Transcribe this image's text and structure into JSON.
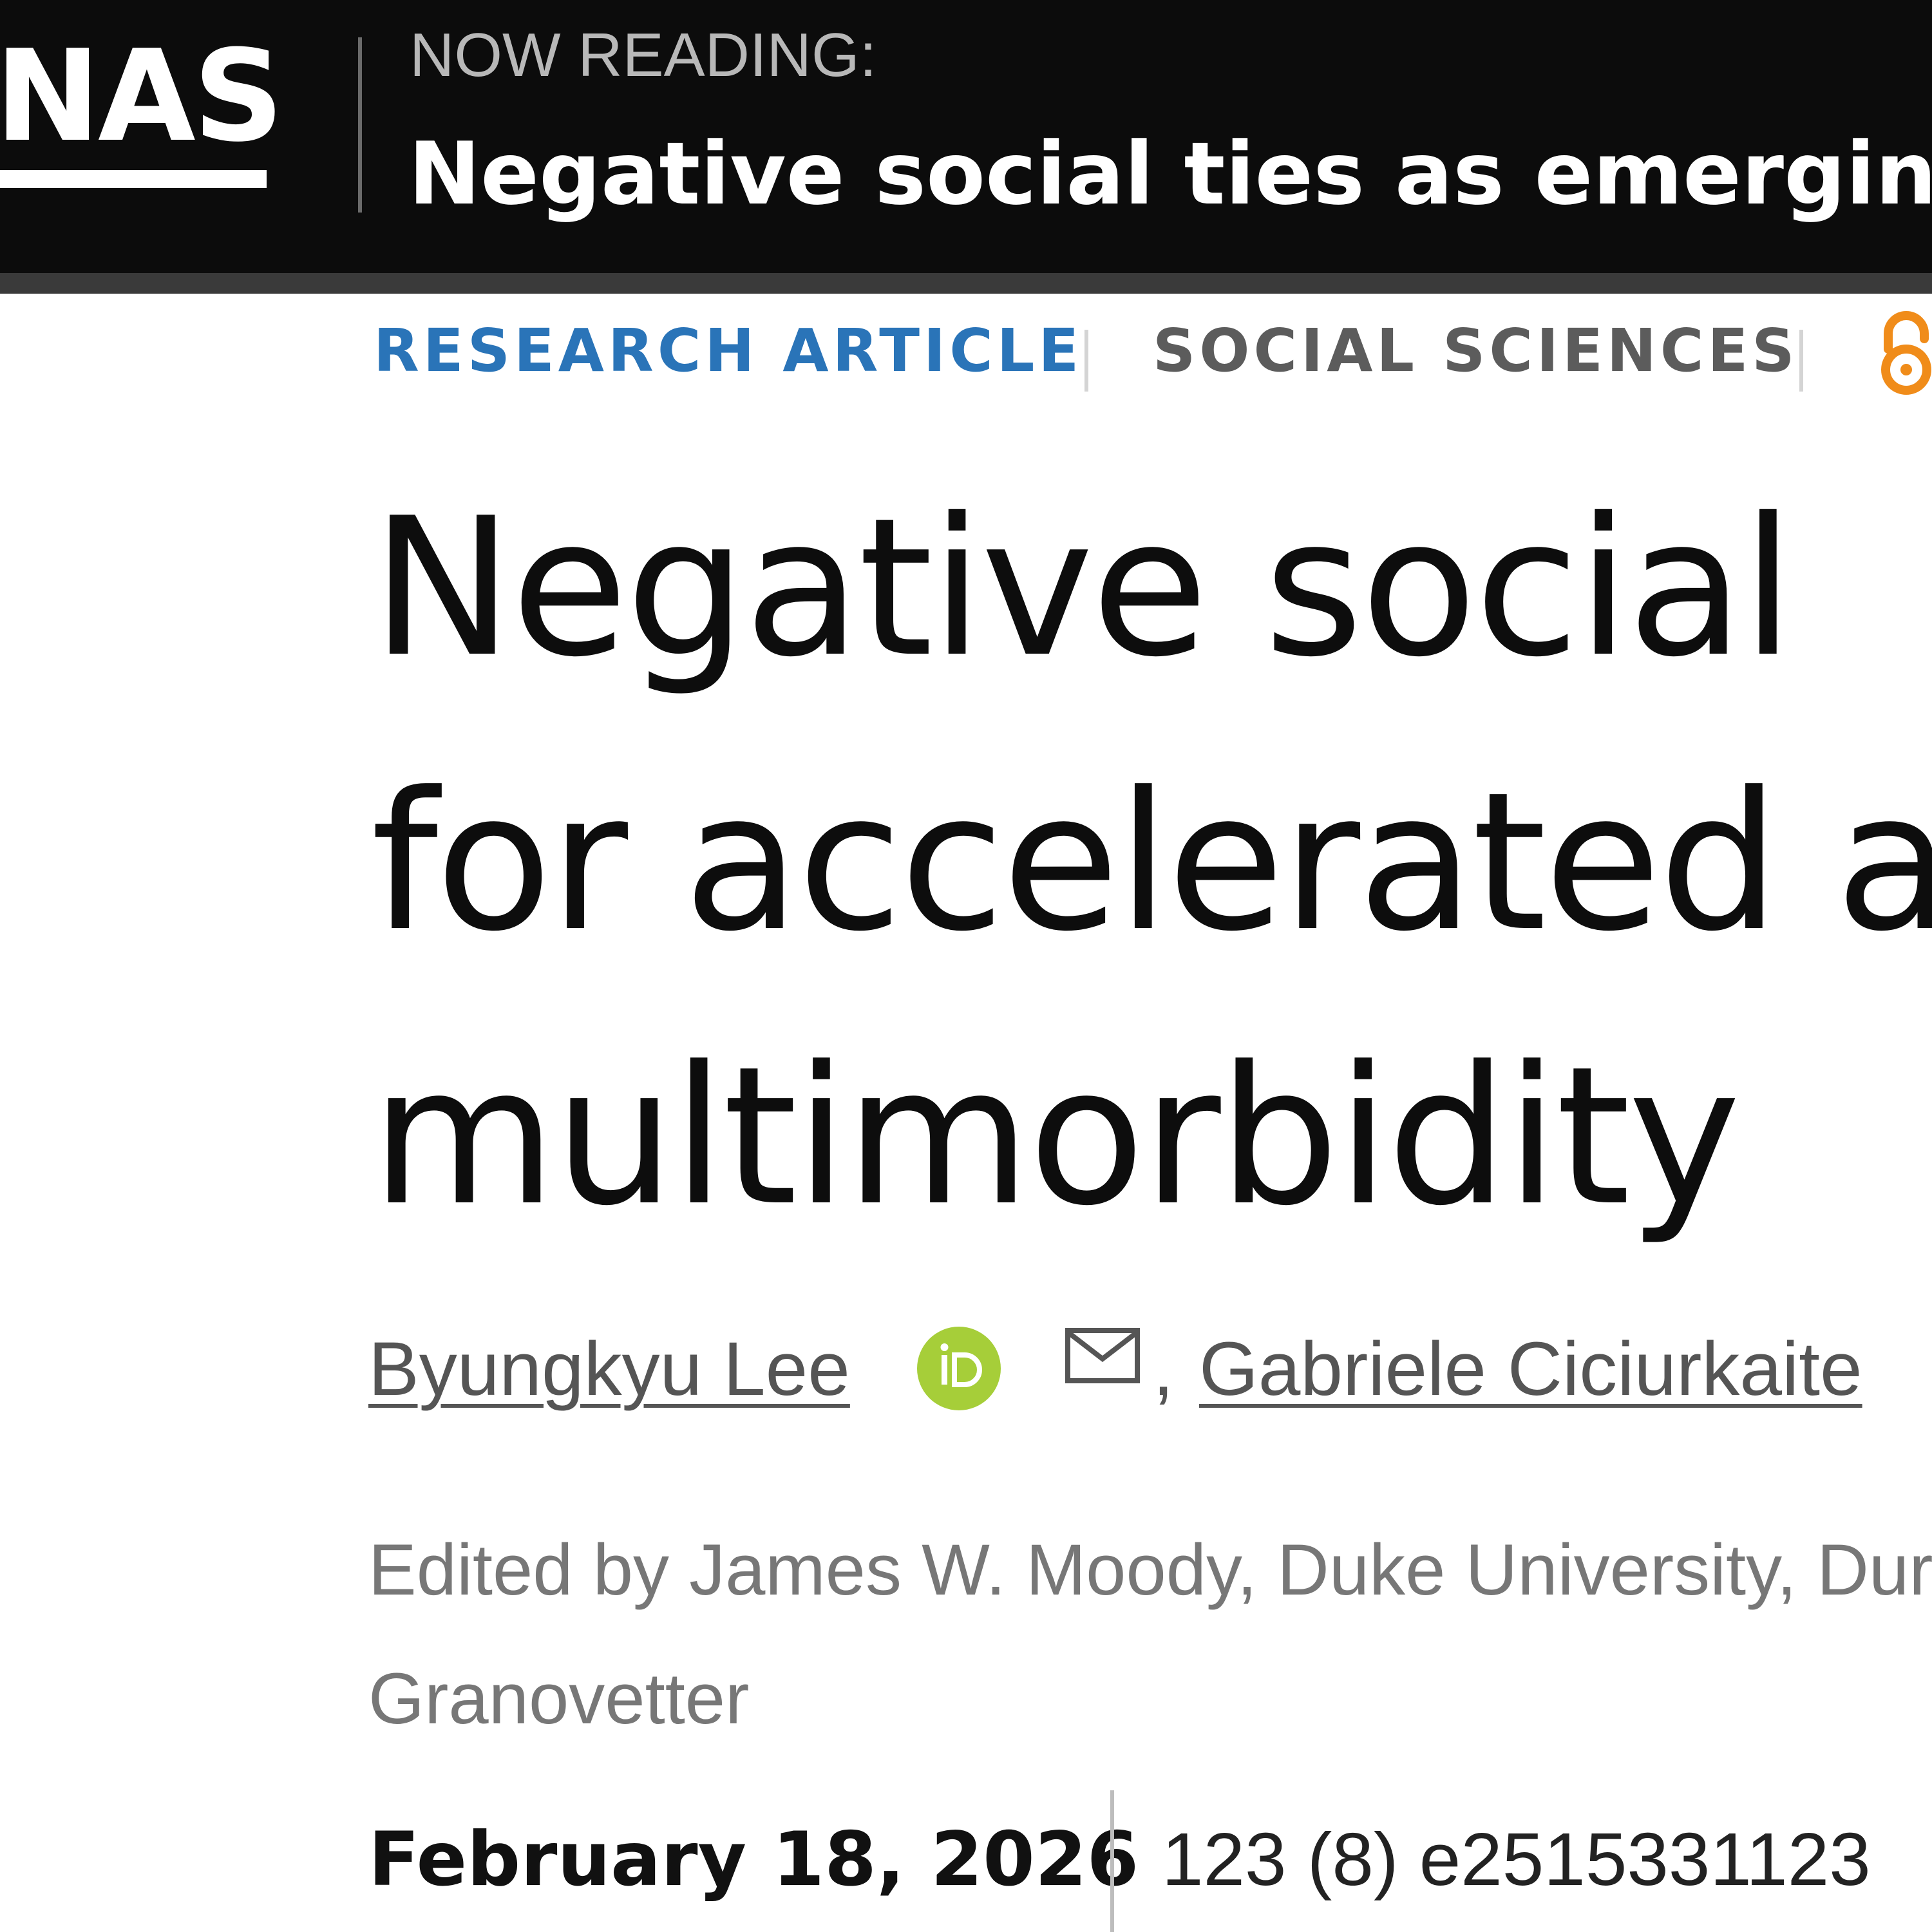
{
  "header": {
    "logo_text": "NAS",
    "now_reading_label": "NOW READING:",
    "now_reading_title": "Negative social ties as emerging"
  },
  "article": {
    "type_label": "RESEARCH ARTICLE",
    "section_label": "SOCIAL SCIENCES",
    "open_access_icon": "open-access-icon",
    "title_lines": [
      "Negative social",
      "for accelerated a",
      "multimorbidity"
    ],
    "authors": [
      {
        "name": "Byungkyu Lee"
      },
      {
        "name": "Gabriele Ciciurkaite"
      }
    ],
    "author_separator": ",",
    "edited_by_lines": [
      "Edited by James W. Moody, Duke University, Durh",
      "Granovetter"
    ],
    "pub_date": "February 18, 2026",
    "citation": "123 (8) e2515331123"
  },
  "colors": {
    "topbar_bg": "#0c0c0c",
    "accent_blue": "#2a74b8",
    "open_access_orange": "#f08c1a",
    "orcid_green": "#a6ce39"
  }
}
